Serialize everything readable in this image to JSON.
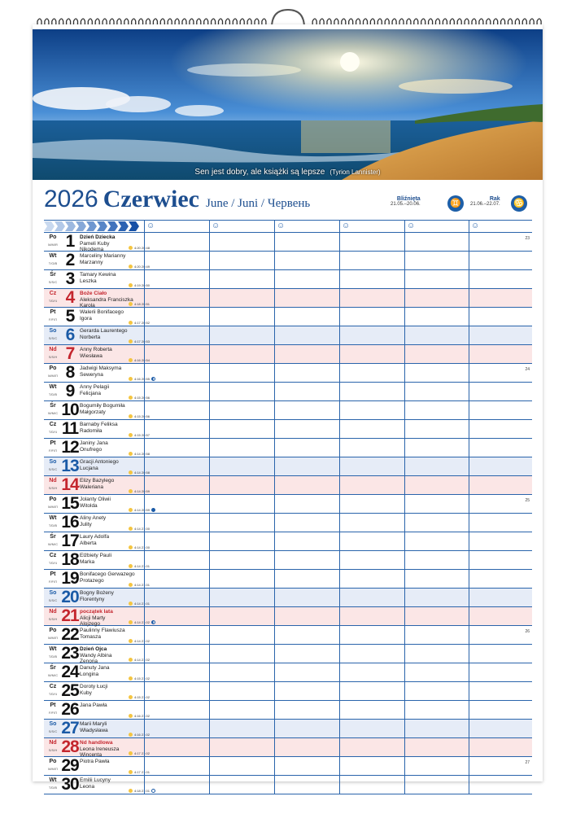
{
  "quote": {
    "text": "Sen jest dobry, ale książki są lepsze",
    "author": "(Tyrion Lannister)"
  },
  "header": {
    "year": "2026",
    "month": "Czerwiec",
    "month_alt": "June / Juni / Червень"
  },
  "zodiac": [
    {
      "name": "Bliźnięta",
      "range": "21.05.–20.06.",
      "icon": "gemini-icon",
      "glyph": "♊"
    },
    {
      "name": "Rak",
      "range": "21.06.–22.07.",
      "icon": "cancer-icon",
      "glyph": "♋"
    }
  ],
  "colors": {
    "accent": "#1d4e8f",
    "saturday": "#e6ecf7",
    "sunday": "#fbe6e6",
    "sunday_text": "#c4262e",
    "saturday_text": "#1a5aa6"
  },
  "column_icon": "smiley-icon",
  "days": [
    {
      "dow": "Po",
      "sub": "M/M/R",
      "num": "1",
      "holiday": "Dzień Dziecka",
      "names": [
        "Pameli Kuby",
        "Nikodema"
      ],
      "sunrise": "4:20",
      "sunset": "20:48",
      "week": "23"
    },
    {
      "dow": "Wt",
      "sub": "T/G/B",
      "num": "2",
      "names": [
        "Marceliny Marianny",
        "Marzanny"
      ],
      "sunrise": "4:20",
      "sunset": "20:49"
    },
    {
      "dow": "Śr",
      "sub": "S/S/С",
      "num": "3",
      "names": [
        "Tamary Kewina",
        "Leszka"
      ],
      "sunrise": "4:19",
      "sunset": "20:50"
    },
    {
      "dow": "Cz",
      "sub": "T/D/Ч",
      "num": "4",
      "type": "sun",
      "holiday": "Boże Ciało",
      "names": [
        "Aleksandra Franciszka",
        "Karola"
      ],
      "sunrise": "4:18",
      "sunset": "20:51"
    },
    {
      "dow": "Pt",
      "sub": "F/F/П",
      "num": "5",
      "names": [
        "Walerii Bonifacego",
        "Igora"
      ],
      "sunrise": "4:17",
      "sunset": "20:52"
    },
    {
      "dow": "So",
      "sub": "S/S/С",
      "num": "6",
      "type": "sat",
      "names": [
        "Gerarda Laurentego",
        "Norberta"
      ],
      "sunrise": "4:17",
      "sunset": "20:53"
    },
    {
      "dow": "Nd",
      "sub": "S/S/Н",
      "num": "7",
      "type": "sun",
      "names": [
        "Anny Roberta",
        "Wiesława"
      ],
      "sunrise": "4:16",
      "sunset": "20:54"
    },
    {
      "dow": "Po",
      "sub": "M/M/П",
      "num": "8",
      "names": [
        "Jadwigi Maksyma",
        "Seweryna"
      ],
      "sunrise": "4:16",
      "sunset": "20:55",
      "moon": "half",
      "week": "24"
    },
    {
      "dow": "Wt",
      "sub": "T/D/В",
      "num": "9",
      "names": [
        "Anny Pelagii",
        "Felicjana"
      ],
      "sunrise": "4:15",
      "sunset": "20:56"
    },
    {
      "dow": "Śr",
      "sub": "W/M/С",
      "num": "10",
      "names": [
        "Bogumiły Bogumiła",
        "Małgorzaty"
      ],
      "sunrise": "4:15",
      "sunset": "20:56"
    },
    {
      "dow": "Cz",
      "sub": "T/D/Ч",
      "num": "11",
      "names": [
        "Barnaby Feliksa",
        "Radomiła"
      ],
      "sunrise": "4:15",
      "sunset": "20:57"
    },
    {
      "dow": "Pt",
      "sub": "F/F/П",
      "num": "12",
      "names": [
        "Janiny Jana",
        "Onufrego"
      ],
      "sunrise": "4:14",
      "sunset": "20:58"
    },
    {
      "dow": "So",
      "sub": "S/S/С",
      "num": "13",
      "type": "sat",
      "names": [
        "Gracji Antoniego",
        "Lucjana"
      ],
      "sunrise": "4:14",
      "sunset": "20:58"
    },
    {
      "dow": "Nd",
      "sub": "S/S/Н",
      "num": "14",
      "type": "sun",
      "names": [
        "Elizy Bazylego",
        "Waleriana"
      ],
      "sunrise": "4:14",
      "sunset": "20:59"
    },
    {
      "dow": "Po",
      "sub": "M/M/П",
      "num": "15",
      "names": [
        "Jolanty Oliwii",
        "Witolda"
      ],
      "sunrise": "4:14",
      "sunset": "20:59",
      "moon": "new",
      "week": "25"
    },
    {
      "dow": "Wt",
      "sub": "T/D/В",
      "num": "16",
      "names": [
        "Aliny Anety",
        "Julity"
      ],
      "sunrise": "4:14",
      "sunset": "21:00"
    },
    {
      "dow": "Śr",
      "sub": "W/M/С",
      "num": "17",
      "names": [
        "Laury Adolfa",
        "Alberta"
      ],
      "sunrise": "4:14",
      "sunset": "21:00"
    },
    {
      "dow": "Cz",
      "sub": "T/D/Ч",
      "num": "18",
      "names": [
        "Elżbiety Pauli",
        "Marka"
      ],
      "sunrise": "4:14",
      "sunset": "21:01"
    },
    {
      "dow": "Pt",
      "sub": "F/F/П",
      "num": "19",
      "names": [
        "Bonifacego Gerwazego",
        "Protazego"
      ],
      "sunrise": "4:14",
      "sunset": "21:01"
    },
    {
      "dow": "So",
      "sub": "S/S/С",
      "num": "20",
      "type": "sat",
      "names": [
        "Bogny Bożeny",
        "Florentyny"
      ],
      "sunrise": "4:14",
      "sunset": "21:01"
    },
    {
      "dow": "Nd",
      "sub": "S/S/Н",
      "num": "21",
      "type": "sun",
      "holiday": "początek lata",
      "names": [
        "Alicji Marty",
        "Alojzego"
      ],
      "sunrise": "4:14",
      "sunset": "21:02",
      "moon": "half"
    },
    {
      "dow": "Po",
      "sub": "M/M/П",
      "num": "22",
      "names": [
        "Paulinny Flawiusza",
        "Tomasza"
      ],
      "sunrise": "4:14",
      "sunset": "21:02",
      "week": "26"
    },
    {
      "dow": "Wt",
      "sub": "T/D/В",
      "num": "23",
      "holiday": "Dzień Ojca",
      "names": [
        "Wandy Albina",
        "Zenona"
      ],
      "sunrise": "4:14",
      "sunset": "21:02"
    },
    {
      "dow": "Śr",
      "sub": "W/M/С",
      "num": "24",
      "names": [
        "Danuty Jana",
        "Longina"
      ],
      "sunrise": "4:15",
      "sunset": "21:02"
    },
    {
      "dow": "Cz",
      "sub": "T/D/Ч",
      "num": "25",
      "names": [
        "Doroty Łucji",
        "Kuby"
      ],
      "sunrise": "4:15",
      "sunset": "21:02"
    },
    {
      "dow": "Pt",
      "sub": "F/F/П",
      "num": "26",
      "names": [
        "Jana Pawła"
      ],
      "sunrise": "4:16",
      "sunset": "21:02"
    },
    {
      "dow": "So",
      "sub": "S/S/С",
      "num": "27",
      "type": "sat",
      "names": [
        "Marii Maryli",
        "Władysława"
      ],
      "sunrise": "4:16",
      "sunset": "21:02"
    },
    {
      "dow": "Nd",
      "sub": "S/S/Н",
      "num": "28",
      "type": "sun",
      "holiday": "Nd handlowa",
      "names": [
        "Leona Ireneusza",
        "Wincenta"
      ],
      "sunrise": "4:17",
      "sunset": "21:02"
    },
    {
      "dow": "Po",
      "sub": "M/M/П",
      "num": "29",
      "names": [
        "Piotra Pawła"
      ],
      "sunrise": "4:17",
      "sunset": "21:01",
      "week": "27"
    },
    {
      "dow": "Wt",
      "sub": "T/D/В",
      "num": "30",
      "names": [
        "Emilii Lucyny",
        "Leona"
      ],
      "sunrise": "4:18",
      "sunset": "21:01",
      "moon": "full"
    }
  ]
}
